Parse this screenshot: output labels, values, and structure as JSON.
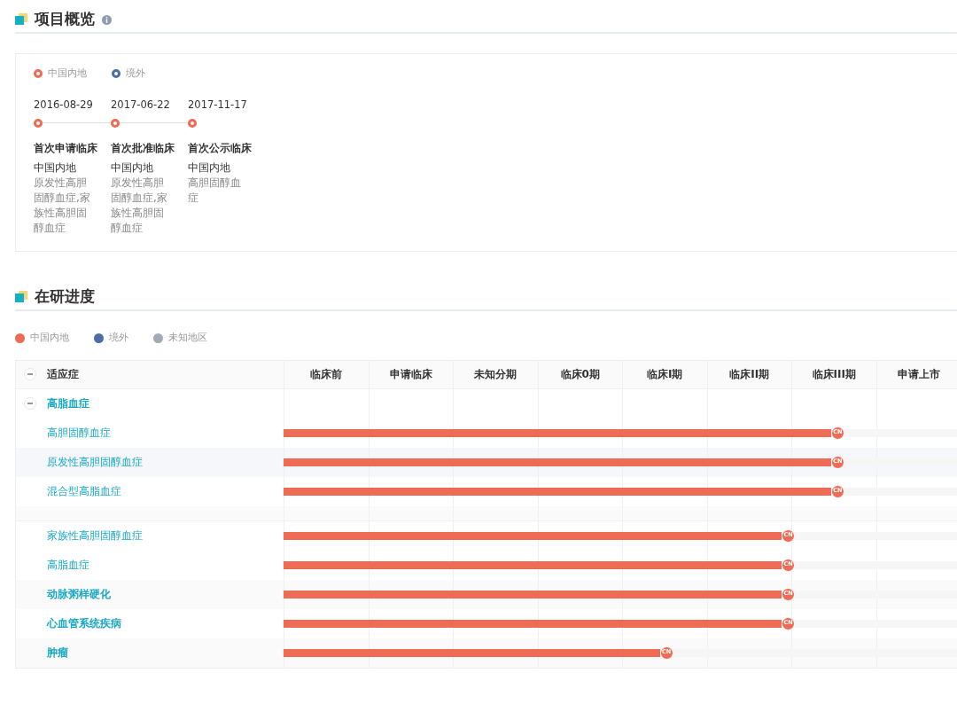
{
  "overview": {
    "title": "项目概览",
    "legend": [
      {
        "label": "中国内地",
        "color": "#ee6c55"
      },
      {
        "label": "境外",
        "color": "#4a6fa5"
      }
    ],
    "milestones": [
      {
        "date": "2016-08-29",
        "color": "#ee6c55",
        "event": "首次申请临床",
        "region": "中国内地",
        "indication": "原发性高胆固醇血症,家族性高胆固醇血症"
      },
      {
        "date": "2017-06-22",
        "color": "#ee6c55",
        "event": "首次批准临床",
        "region": "中国内地",
        "indication": "原发性高胆固醇血症,家族性高胆固醇血症"
      },
      {
        "date": "2017-11-17",
        "color": "#ee6c55",
        "event": "首次公示临床",
        "region": "中国内地",
        "indication": "高胆固醇血症"
      }
    ]
  },
  "progress": {
    "title": "在研进度",
    "legend": [
      {
        "label": "中国内地",
        "color": "#ee6c55"
      },
      {
        "label": "境外",
        "color": "#4a6fa5"
      },
      {
        "label": "未知地区",
        "color": "#a3a9b7"
      }
    ],
    "header_expanded": true,
    "columns": [
      "适应症",
      "临床前",
      "申请临床",
      "未知分期",
      "临床0期",
      "临床I期",
      "临床II期",
      "临床III期",
      "申请上市"
    ],
    "rows": [
      {
        "label": "高脂血症",
        "expanded": true,
        "children": [
          {
            "label": "高胆固醇血症",
            "hovered": false,
            "level": 0.818,
            "marker": "CN",
            "color": "#ee6c55"
          },
          {
            "label": "原发性高胆固醇血症",
            "hovered": true,
            "level": 0.818,
            "marker": "CN",
            "color": "#ee6c55"
          },
          {
            "label": "混合型高脂血症",
            "hovered": false,
            "level": 0.818,
            "marker": "CN",
            "color": "#ee6c55"
          },
          {
            "label": "家族性高胆固醇血症",
            "hovered": false,
            "level": 0.745,
            "marker": "CN",
            "color": "#ee6c55"
          },
          {
            "label": "高脂血症",
            "hovered": false,
            "level": 0.745,
            "marker": "CN",
            "color": "#ee6c55"
          }
        ]
      },
      {
        "label": "动脉粥样硬化",
        "level": 0.745,
        "marker": "CN",
        "color": "#ee6c55"
      },
      {
        "label": "心血管系统疾病",
        "level": 0.745,
        "marker": "CN",
        "color": "#ee6c55"
      },
      {
        "label": "肿瘤",
        "level": 0.565,
        "marker": "CN",
        "color": "#ee6c55"
      }
    ]
  }
}
